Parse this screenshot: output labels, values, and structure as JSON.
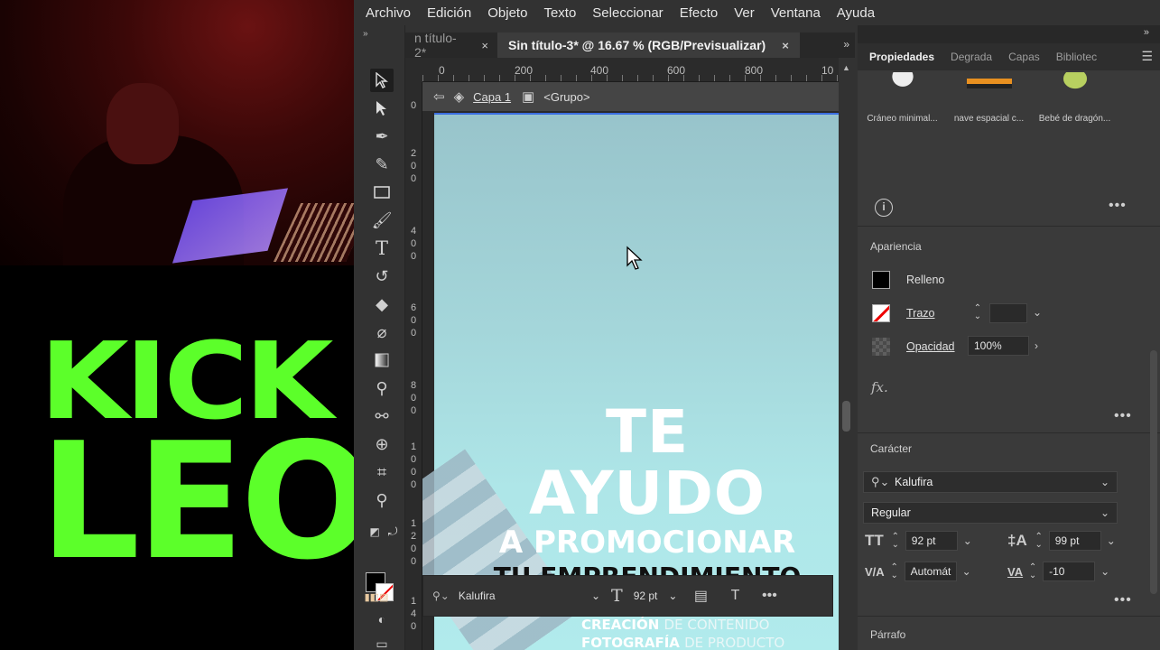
{
  "menu": [
    "Archivo",
    "Edición",
    "Objeto",
    "Texto",
    "Seleccionar",
    "Efecto",
    "Ver",
    "Ventana",
    "Ayuda"
  ],
  "logo": {
    "line1": "KICK",
    "line2": "LEO",
    "color": "#5cff2a"
  },
  "tabs": {
    "inactive": "n título-2*",
    "active": "Sin título-3* @ 16.67 % (RGB/Previsualizar)",
    "close_glyph": "×"
  },
  "ruler": {
    "h": [
      "0",
      "200",
      "400",
      "600",
      "800",
      "10"
    ]
  },
  "isolation": {
    "layer": "Capa 1",
    "group": "<Grupo>"
  },
  "artwork": {
    "line1": "TE AYUDO",
    "line2": "A PROMOCIONAR",
    "line3": "TU EMPRENDIMIENTO",
    "sub1_bold": "CREACIÓN",
    "sub1_rest": "DE CONTENIDO",
    "sub2_bold": "FOTOGRAFÍA",
    "sub2_rest": "DE PRODUCTO"
  },
  "context_bar": {
    "font": "Kalufira",
    "size": "92 pt"
  },
  "panel": {
    "tabs": [
      "Propiedades",
      "Degrada",
      "Capas",
      "Bibliotec"
    ],
    "library_items": [
      "Cráneo minimal...",
      "nave espacial c...",
      "Bebé de dragón..."
    ],
    "appearance": {
      "title": "Apariencia",
      "fill_label": "Relleno",
      "stroke_label": "Trazo",
      "opacity_label": "Opacidad",
      "opacity_value": "100%",
      "fx": "fx."
    },
    "character": {
      "title": "Carácter",
      "font": "Kalufira",
      "style": "Regular",
      "size": "92 pt",
      "leading": "99 pt",
      "kerning": "Automát",
      "tracking": "-10"
    },
    "paragraph_title": "Párrafo"
  },
  "colors": {
    "accent_blue": "#3b6ee0",
    "fill": "#000000",
    "stroke_slash": "#e00000"
  }
}
